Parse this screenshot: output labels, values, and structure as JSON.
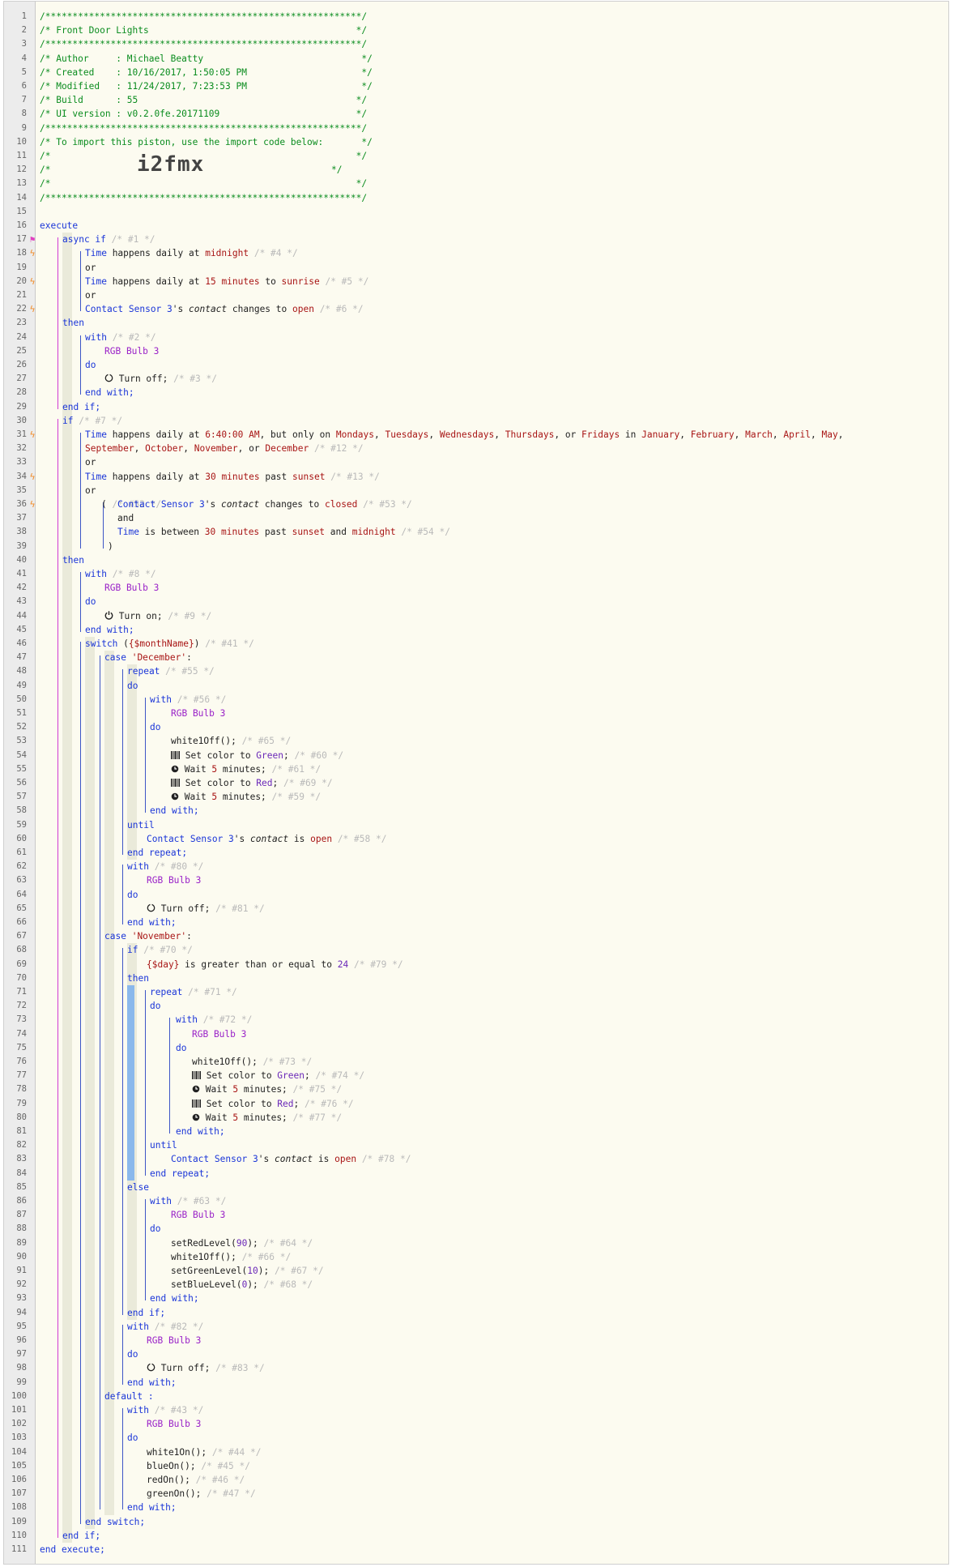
{
  "header": {
    "stars": "/**********************************************************/",
    "title": "/* Front Door Lights                                      */",
    "author": "/* Author     : Michael Beatty                             */",
    "created": "/* Created    : 10/16/2017, 1:50:05 PM                     */",
    "modified": "/* Modified   : 11/24/2017, 7:23:53 PM                     */",
    "build": "/* Build      : 55                                        */",
    "ui_version": "/* UI version : v0.2.0fe.20171109                         */",
    "import_note": "/* To import this piston, use the import code below:       */",
    "blank": "/*                                                        */",
    "import_prefix": "/*",
    "import_code": "i2fmx",
    "import_suffix": "*/"
  },
  "code": {
    "execute": "execute",
    "end_execute": "end execute;",
    "async_if": "async if",
    "if": "if",
    "then": "then",
    "else": "else",
    "end_if": "end if;",
    "or": "or",
    "and": "and",
    "with": "with",
    "do": "do",
    "end_with": "end with;",
    "switch": "switch",
    "case": "case",
    "default": "default :",
    "end_switch": "end switch;",
    "repeat": "repeat",
    "until": "until",
    "end_repeat": "end repeat;",
    "device": "RGB Bulb 3",
    "sensor": "Contact Sensor 3",
    "time": "Time",
    "paren_open": "(",
    "paren_close": ")"
  },
  "icons": {
    "power": "power-icon",
    "clock": "clock-icon",
    "barcode": "barcode-icon",
    "trigger": "lightning-bolt-icon",
    "flag": "flag-icon"
  },
  "colors": {
    "comment": "#0a8c1e",
    "keyword": "#1a35d8",
    "value": "#a81515",
    "device": "#9a22c8",
    "faded": "#b9b9b9",
    "trigger": "#f08a24"
  }
}
